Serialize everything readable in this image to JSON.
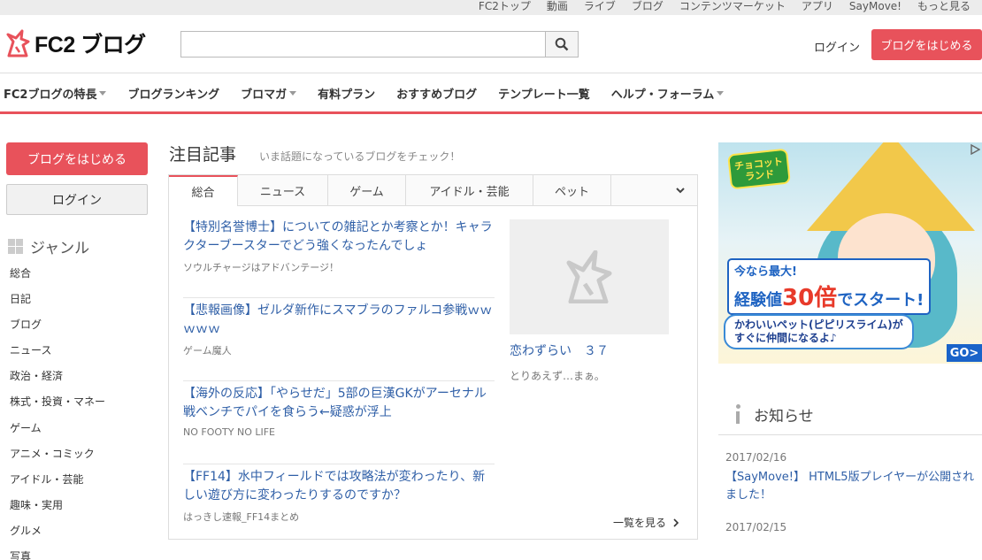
{
  "topbar": [
    "FC2トップ",
    "動画",
    "ライブ",
    "ブログ",
    "コンテンツマーケット",
    "アプリ",
    "SayMove!",
    "もっと見る"
  ],
  "header": {
    "logo_text": "FC2 ブログ",
    "search_value": "",
    "login": "ログイン",
    "start": "ブログをはじめる"
  },
  "gnav": [
    {
      "label": "FC2ブログの特長",
      "dropdown": true
    },
    {
      "label": "ブログランキング",
      "dropdown": false
    },
    {
      "label": "ブロマガ",
      "dropdown": true
    },
    {
      "label": "有料プラン",
      "dropdown": false
    },
    {
      "label": "おすすめブログ",
      "dropdown": false
    },
    {
      "label": "テンプレート一覧",
      "dropdown": false
    },
    {
      "label": "ヘルプ・フォーラム",
      "dropdown": true
    }
  ],
  "sidebar": {
    "start": "ブログをはじめる",
    "login": "ログイン",
    "genre_title": "ジャンル",
    "genres": [
      "総合",
      "日記",
      "ブログ",
      "ニュース",
      "政治・経済",
      "株式・投資・マネー",
      "ゲーム",
      "アニメ・コミック",
      "アイドル・芸能",
      "趣味・実用",
      "グルメ",
      "写真"
    ]
  },
  "featured": {
    "title": "注目記事",
    "subtitle": "いま話題になっているブログをチェック！",
    "tabs": [
      "総合",
      "ニュース",
      "ゲーム",
      "アイドル・芸能",
      "ペット"
    ],
    "active_tab": 0,
    "articles": [
      {
        "title": "【特別名誉博士】についての雑記とか考察とか！キャラクターブースターでどう強くなったんでしょ",
        "source": "ソウルチャージはアドバンテージ！"
      },
      {
        "title": "【悲報画像】ゼルダ新作にスマブラのファルコ参戦ｗｗｗｗｗ",
        "source": "ゲーム魔人"
      },
      {
        "title": "【海外の反応】「やらせだ」5部の巨漢GKがアーセナル戦ベンチでパイを食らう←疑惑が浮上",
        "source": "NO FOOTY NO LIFE"
      },
      {
        "title": "【FF14】水中フィールドでは攻略法が変わったり、新しい遊び方に変わったりするのですか？",
        "source": "はっきし速報_FF14まとめ"
      }
    ],
    "feature": {
      "title": "恋わずらい　３７",
      "source": "とりあえず…まぁ。"
    },
    "see_all": "一覧を見る"
  },
  "ad": {
    "brand": "チョコットランド",
    "copy1_pre": "今なら最大!",
    "copy1_mid": "経験値",
    "copy1_big": "30倍",
    "copy1_post": "でスタート!",
    "copy2_line1": "かわいいペット(ピピリスライム)が",
    "copy2_line2": "すぐに仲間になるよ♪",
    "go": "GO>"
  },
  "news": {
    "title": "お知らせ",
    "items": [
      {
        "date": "2017/02/16",
        "title": "【SayMove!】 HTML5版プレイヤーが公開されました！"
      },
      {
        "date": "2017/02/15",
        "title": ""
      }
    ]
  },
  "colors": {
    "accent": "#e8525b",
    "link": "#2f5fa7"
  }
}
